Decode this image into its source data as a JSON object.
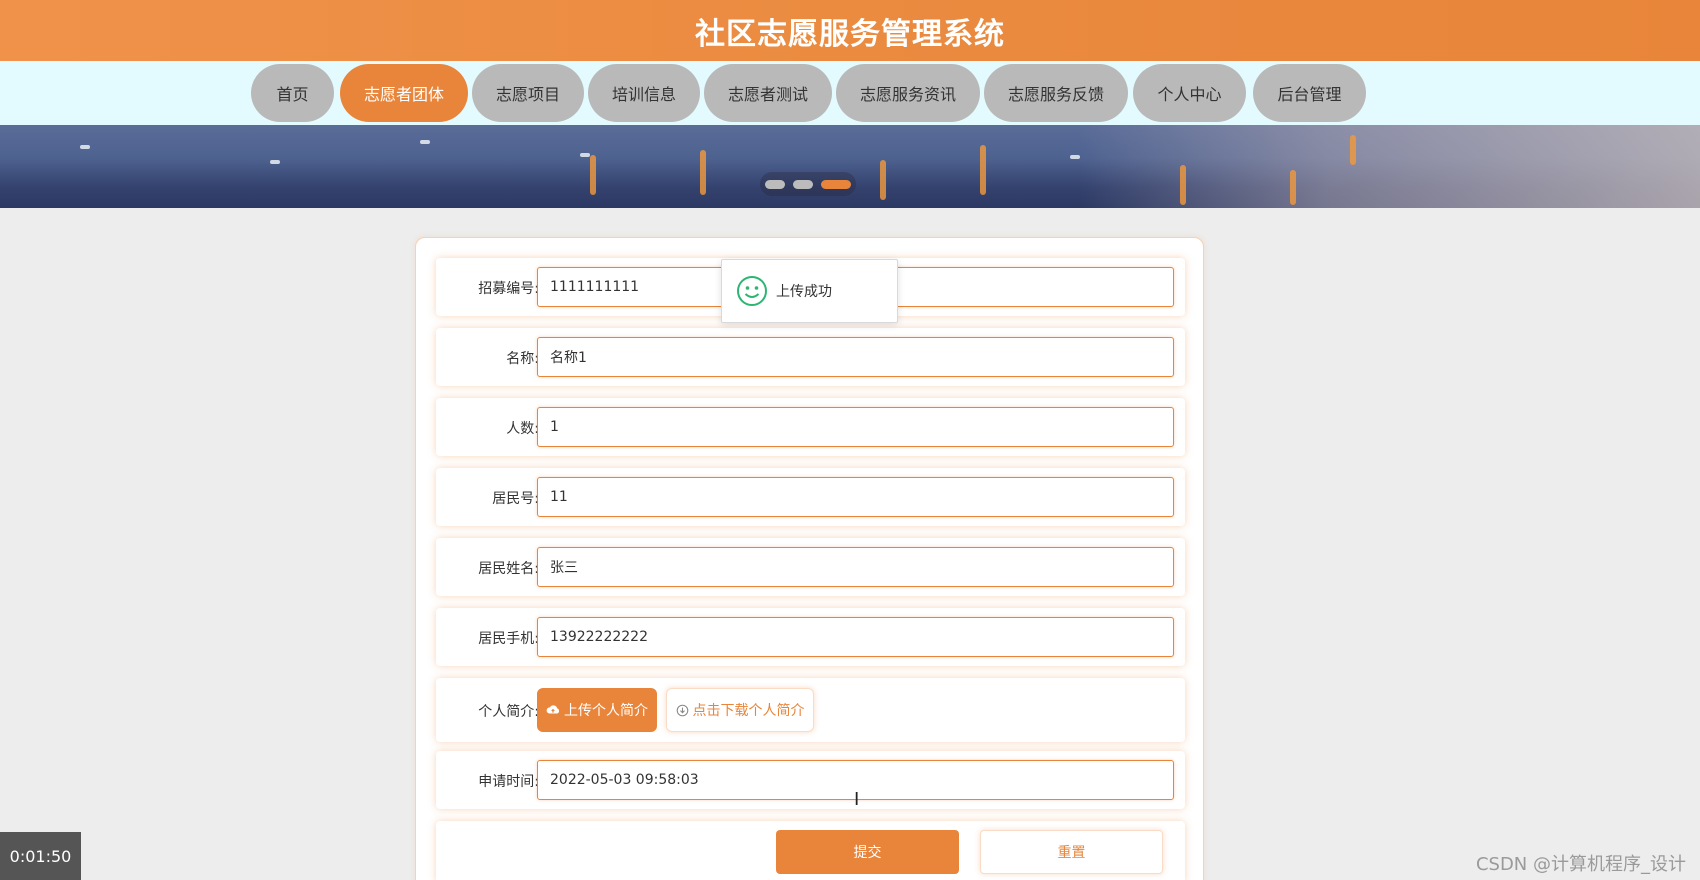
{
  "header": {
    "title": "社区志愿服务管理系统"
  },
  "nav": {
    "items": [
      {
        "label": "首页",
        "active": false
      },
      {
        "label": "志愿者团体",
        "active": true
      },
      {
        "label": "志愿项目",
        "active": false
      },
      {
        "label": "培训信息",
        "active": false
      },
      {
        "label": "志愿者测试",
        "active": false
      },
      {
        "label": "志愿服务资讯",
        "active": false
      },
      {
        "label": "志愿服务反馈",
        "active": false
      },
      {
        "label": "个人中心",
        "active": false
      },
      {
        "label": "后台管理",
        "active": false
      }
    ]
  },
  "carousel": {
    "slide_count": 3,
    "active_index": 2
  },
  "form": {
    "fields": [
      {
        "label": "招募编号:",
        "value": "1111111111"
      },
      {
        "label": "名称:",
        "value": "名称1"
      },
      {
        "label": "人数:",
        "value": "1"
      },
      {
        "label": "居民号:",
        "value": "11"
      },
      {
        "label": "居民姓名:",
        "value": "张三"
      },
      {
        "label": "居民手机:",
        "value": "13922222222"
      }
    ],
    "profile": {
      "label": "个人简介:",
      "upload_label": "上传个人简介",
      "download_label": "点击下载个人简介"
    },
    "apply_time": {
      "label": "申请时间:",
      "value": "2022-05-03 09:58:03"
    },
    "submit_label": "提交",
    "reset_label": "重置"
  },
  "toast": {
    "message": "上传成功"
  },
  "overlay": {
    "timer": "0:01:50",
    "watermark": "CSDN @计算机程序_设计"
  },
  "colors": {
    "accent": "#e8853a",
    "nav_inactive": "#b9b9b9",
    "nav_background": "#e3fbfe",
    "page_background": "#ededed",
    "toast_icon": "#2bb673"
  },
  "icons": {
    "toast": "smile-icon",
    "upload": "cloud-upload-icon",
    "download": "download-circle-icon"
  }
}
